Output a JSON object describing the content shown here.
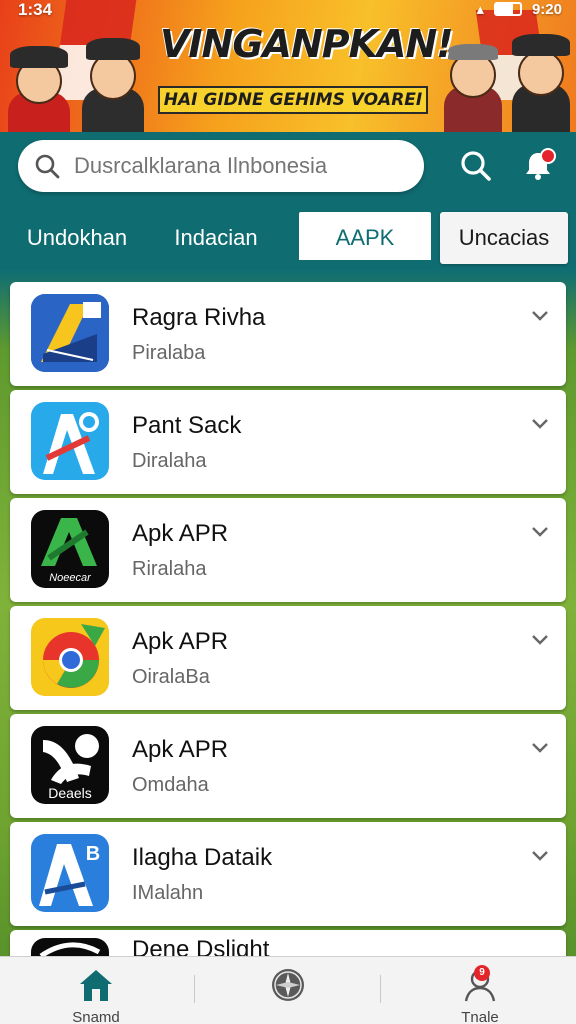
{
  "status_bar": {
    "time": "1:34",
    "clock_right": "9:20"
  },
  "banner": {
    "title": "VINGANPKAN!",
    "subtitle": "HAI GIDNE GEHIMS VOAREI"
  },
  "search": {
    "placeholder": "Dusrcalklarana Ilnbonesia",
    "icon": "search-icon"
  },
  "header_icons": {
    "search": "search-icon",
    "notifications": "bell-icon"
  },
  "tabs": [
    {
      "label": "Undokhan",
      "state": "inactive"
    },
    {
      "label": "Indacian",
      "state": "inactive"
    },
    {
      "label": "AAPK",
      "state": "active"
    },
    {
      "label": "Uncacias",
      "state": "secondary"
    }
  ],
  "apps": [
    {
      "name": "Ragra Rivha",
      "sub": "Piralaba",
      "icon": "blue-yellow-a-icon"
    },
    {
      "name": "Pant Sack",
      "sub": "Diralaha",
      "icon": "light-blue-a-icon"
    },
    {
      "name": "Apk APR",
      "sub": "Riralaha",
      "icon": "green-a-icon",
      "icon_caption": "Noeecar"
    },
    {
      "name": "Apk APR",
      "sub": "OiralaBa",
      "icon": "chrome-like-icon"
    },
    {
      "name": "Apk APR",
      "sub": "Omdaha",
      "icon": "black-swirl-icon",
      "icon_caption": "Deaels"
    },
    {
      "name": "Ilagha Dataik",
      "sub": "IMalahn",
      "icon": "blue-a-b-icon"
    },
    {
      "name": "Dene Dslight",
      "sub": "",
      "icon": "black-partial-icon"
    }
  ],
  "bottom_nav": [
    {
      "label": "Snamd",
      "icon": "home-icon",
      "active": true
    },
    {
      "label": "",
      "icon": "compass-icon",
      "active": false
    },
    {
      "label": "Tnale",
      "icon": "user-icon",
      "badge": "9",
      "active": false
    }
  ],
  "colors": {
    "header_teal": "#0f6d72",
    "accent_red": "#e3242b",
    "banner_orange": "#f6a21c"
  }
}
